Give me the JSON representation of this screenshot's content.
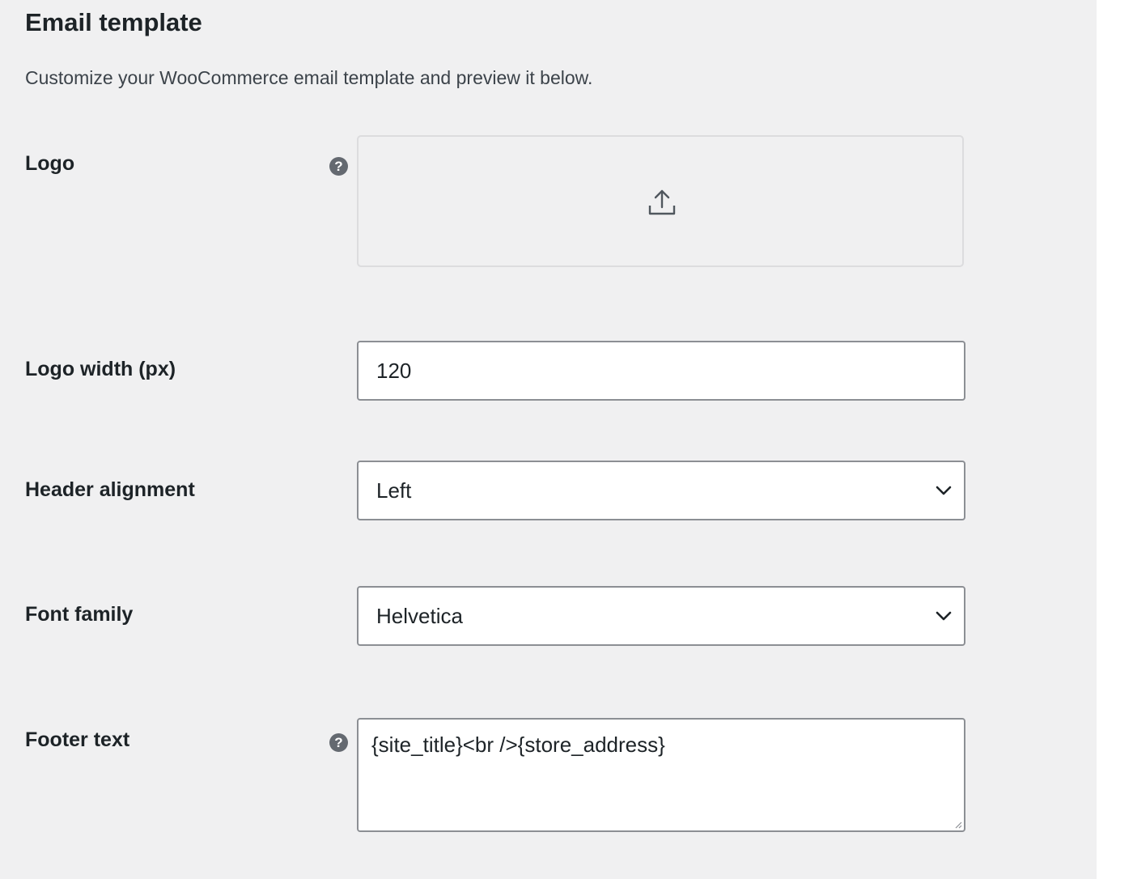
{
  "section": {
    "title": "Email template",
    "description": "Customize your WooCommerce email template and preview it below."
  },
  "fields": {
    "logo": {
      "label": "Logo",
      "help_icon": "question-mark",
      "upload_icon": "upload-icon"
    },
    "logo_width": {
      "label": "Logo width (px)",
      "value": "120"
    },
    "header_alignment": {
      "label": "Header alignment",
      "value": "Left"
    },
    "font_family": {
      "label": "Font family",
      "value": "Helvetica"
    },
    "footer_text": {
      "label": "Footer text",
      "help_icon": "question-mark",
      "value": "{site_title}<br />{store_address}"
    }
  },
  "colors": {
    "panel_bg": "#f0f0f1",
    "text": "#1d2327",
    "field_border": "#8c8f94",
    "help_icon_bg": "#646970"
  }
}
